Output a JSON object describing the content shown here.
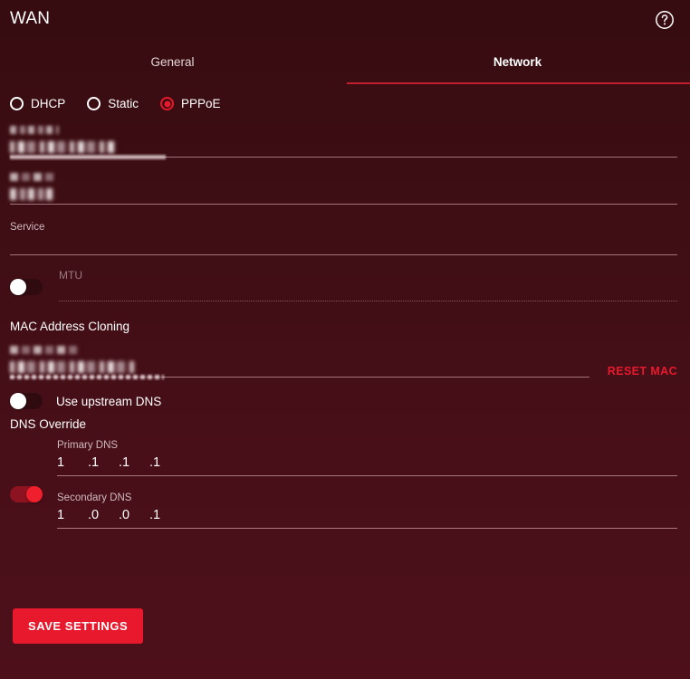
{
  "header": {
    "title": "WAN",
    "help_icon": "help-circle-icon"
  },
  "tabs": [
    {
      "label": "General",
      "active": false
    },
    {
      "label": "Network",
      "active": true
    }
  ],
  "connection_modes": [
    {
      "label": "DHCP",
      "selected": false
    },
    {
      "label": "Static",
      "selected": false
    },
    {
      "label": "PPPoE",
      "selected": true
    }
  ],
  "fields": {
    "username": {
      "label": "",
      "label_redacted": true,
      "value": "",
      "value_redacted": true,
      "has_selection_highlight": true
    },
    "password": {
      "label": "",
      "label_redacted": true,
      "value": "",
      "value_redacted": true,
      "has_selection_highlight": false
    },
    "service": {
      "label": "Service",
      "value": "",
      "placeholder": ""
    },
    "mtu": {
      "label": "MTU",
      "value": "",
      "enabled": false,
      "toggle_state": "off"
    }
  },
  "mac_cloning": {
    "heading": "MAC Address Cloning",
    "label": "",
    "label_redacted": true,
    "value": "",
    "value_redacted": true,
    "reset_label": "RESET MAC"
  },
  "dns": {
    "upstream_label": "Use upstream DNS",
    "upstream_toggle_state": "off",
    "override_heading": "DNS Override",
    "override_toggle_state": "on",
    "primary": {
      "label": "Primary DNS",
      "octets": [
        "1",
        ".1",
        ".1",
        ".1"
      ]
    },
    "secondary": {
      "label": "Secondary DNS",
      "octets": [
        "1",
        ".0",
        ".0",
        ".1"
      ]
    }
  },
  "actions": {
    "save_label": "SAVE SETTINGS"
  },
  "colors": {
    "accent_red": "#e8192c",
    "tab_underline": "#c0202c",
    "background_top": "#360c10",
    "background_bottom": "#4d101a",
    "rule": "#c79ba2"
  }
}
